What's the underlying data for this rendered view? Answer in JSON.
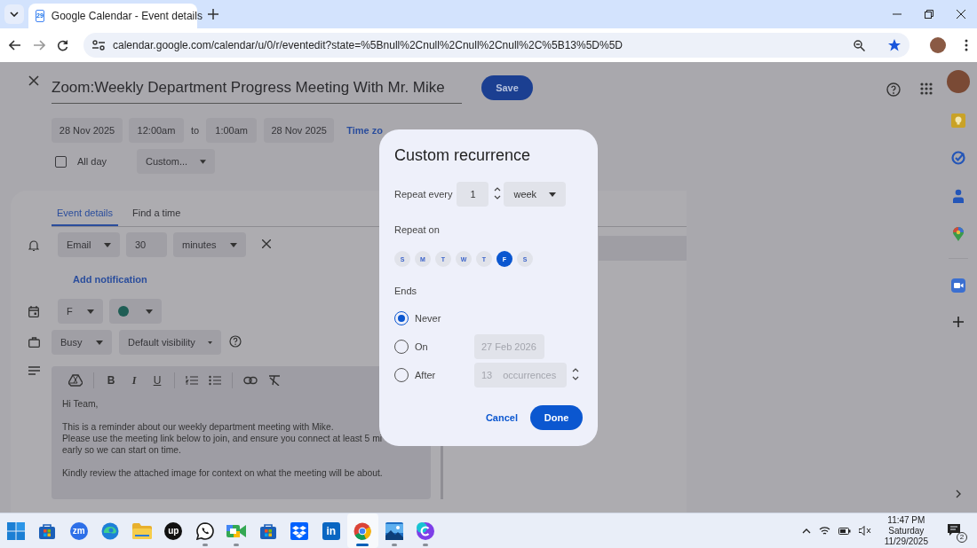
{
  "browser": {
    "tab_icon_text": "29",
    "tab_title": "Google Calendar - Event details",
    "url": "calendar.google.com/calendar/u/0/r/eventedit?state=%5Bnull%2Cnull%2Cnull%2Cnull%2C%5B13%5D%5D"
  },
  "event": {
    "title": "Zoom:Weekly Department Progress Meeting With Mr. Mike",
    "save": "Save",
    "start_date": "28 Nov 2025",
    "start_time": "12:00am",
    "to": "to",
    "end_time": "1:00am",
    "end_date": "28 Nov 2025",
    "time_zone": "Time zo",
    "all_day": {
      "label": "All day",
      "checked": false
    },
    "recurrence": "Custom..."
  },
  "tabs": [
    {
      "label": "Event details",
      "selected": true
    },
    {
      "label": "Find a time",
      "selected": false
    }
  ],
  "notification": {
    "method": "Email",
    "amount": "30",
    "unit": "minutes"
  },
  "add_notification": "Add notification",
  "calendar": {
    "name": "F",
    "color": "#1f5e55"
  },
  "availability": "Busy",
  "visibility": "Default visibility",
  "toolbar": [
    {
      "kind": "drive"
    },
    {
      "kind": "separator"
    },
    {
      "kind": "bold",
      "label": "B"
    },
    {
      "kind": "italic",
      "label": "I"
    },
    {
      "kind": "underline",
      "label": "U"
    },
    {
      "kind": "separator"
    },
    {
      "kind": "numbered"
    },
    {
      "kind": "bulleted"
    },
    {
      "kind": "separator"
    },
    {
      "kind": "link"
    },
    {
      "kind": "clear"
    }
  ],
  "description": [
    [
      "Hi Team,"
    ],
    [
      "This is a reminder about our weekly department meeting with Mike.",
      "Please use the meeting link below to join, and ensure you connect at least 5 mi",
      "early so we can start on time."
    ],
    [
      "Kindly review the attached image for context on what the meeting will be about."
    ]
  ],
  "dialog": {
    "title": "Custom recurrence",
    "repeat_every_label": "Repeat every",
    "interval": "1",
    "unit": "week",
    "repeat_on_label": "Repeat on",
    "days": [
      {
        "label": "S",
        "selected": false
      },
      {
        "label": "M",
        "selected": false
      },
      {
        "label": "T",
        "selected": false
      },
      {
        "label": "W",
        "selected": false
      },
      {
        "label": "T",
        "selected": false
      },
      {
        "label": "F",
        "selected": true
      },
      {
        "label": "S",
        "selected": false
      }
    ],
    "ends_label": "Ends",
    "ends": [
      {
        "kind": "never",
        "label": "Never",
        "selected": true
      },
      {
        "kind": "date",
        "label": "On",
        "selected": false,
        "value": "27 Feb 2026"
      },
      {
        "kind": "count",
        "label": "After",
        "selected": false,
        "value": "13",
        "suffix": "occurrences"
      }
    ],
    "cancel": "Cancel",
    "done": "Done"
  },
  "taskbar": {
    "apps": [
      {
        "kind": "start",
        "running": false,
        "selected": false
      },
      {
        "kind": "store",
        "running": false,
        "selected": false
      },
      {
        "kind": "zoom",
        "label": "zm",
        "running": false,
        "selected": false
      },
      {
        "kind": "edge",
        "running": false,
        "selected": false
      },
      {
        "kind": "files",
        "running": false,
        "selected": false
      },
      {
        "kind": "upwork",
        "label": "up",
        "running": false,
        "selected": false
      },
      {
        "kind": "whatsapp",
        "running": true,
        "selected": false
      },
      {
        "kind": "meet",
        "running": true,
        "selected": false
      },
      {
        "kind": "store",
        "running": false,
        "selected": false
      },
      {
        "kind": "dropbox",
        "running": false,
        "selected": false
      },
      {
        "kind": "linkedin",
        "label": "in",
        "running": false,
        "selected": false
      },
      {
        "kind": "chrome",
        "running": true,
        "selected": true
      },
      {
        "kind": "photos",
        "running": true,
        "selected": false
      },
      {
        "kind": "canva",
        "running": true,
        "selected": false
      }
    ],
    "clock": {
      "time": "11:47 PM",
      "day": "Saturday",
      "date": "11/29/2025"
    },
    "notification_count": "2"
  }
}
